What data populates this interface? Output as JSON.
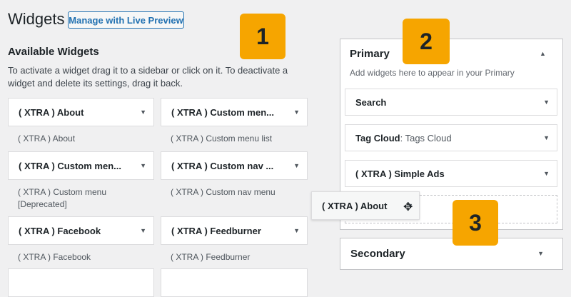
{
  "header": {
    "title": "Widgets",
    "live_preview_label": "Manage with Live Preview"
  },
  "available": {
    "title": "Available Widgets",
    "description": "To activate a widget drag it to a sidebar or click on it. To deactivate a widget and delete its settings, drag it back.",
    "widgets": [
      {
        "title": "( XTRA ) About",
        "description": "( XTRA ) About"
      },
      {
        "title": "( XTRA ) Custom men...",
        "description": "( XTRA ) Custom menu list"
      },
      {
        "title": "( XTRA ) Custom men...",
        "description": "( XTRA ) Custom menu [Deprecated]"
      },
      {
        "title": "( XTRA ) Custom nav ...",
        "description": "( XTRA ) Custom nav menu"
      },
      {
        "title": "( XTRA ) Facebook",
        "description": "( XTRA ) Facebook"
      },
      {
        "title": "( XTRA ) Feedburner",
        "description": "( XTRA ) Feedburner"
      }
    ]
  },
  "sidebars": {
    "primary": {
      "title": "Primary",
      "description": "Add widgets here to appear in your Primary",
      "widgets": [
        {
          "title": "Search",
          "subtitle": ""
        },
        {
          "title": "Tag Cloud",
          "subtitle": ": Tags Cloud"
        },
        {
          "title": "( XTRA ) Simple Ads",
          "subtitle": ""
        }
      ]
    },
    "secondary": {
      "title": "Secondary"
    }
  },
  "dragging_widget": {
    "title": "( XTRA ) About"
  },
  "callouts": [
    "1",
    "2",
    "3"
  ],
  "icons": {
    "caret_down": "▼",
    "caret_up": "▲",
    "move": "✥"
  },
  "colors": {
    "accent": "#2271b1",
    "callout": "#f6a500"
  }
}
